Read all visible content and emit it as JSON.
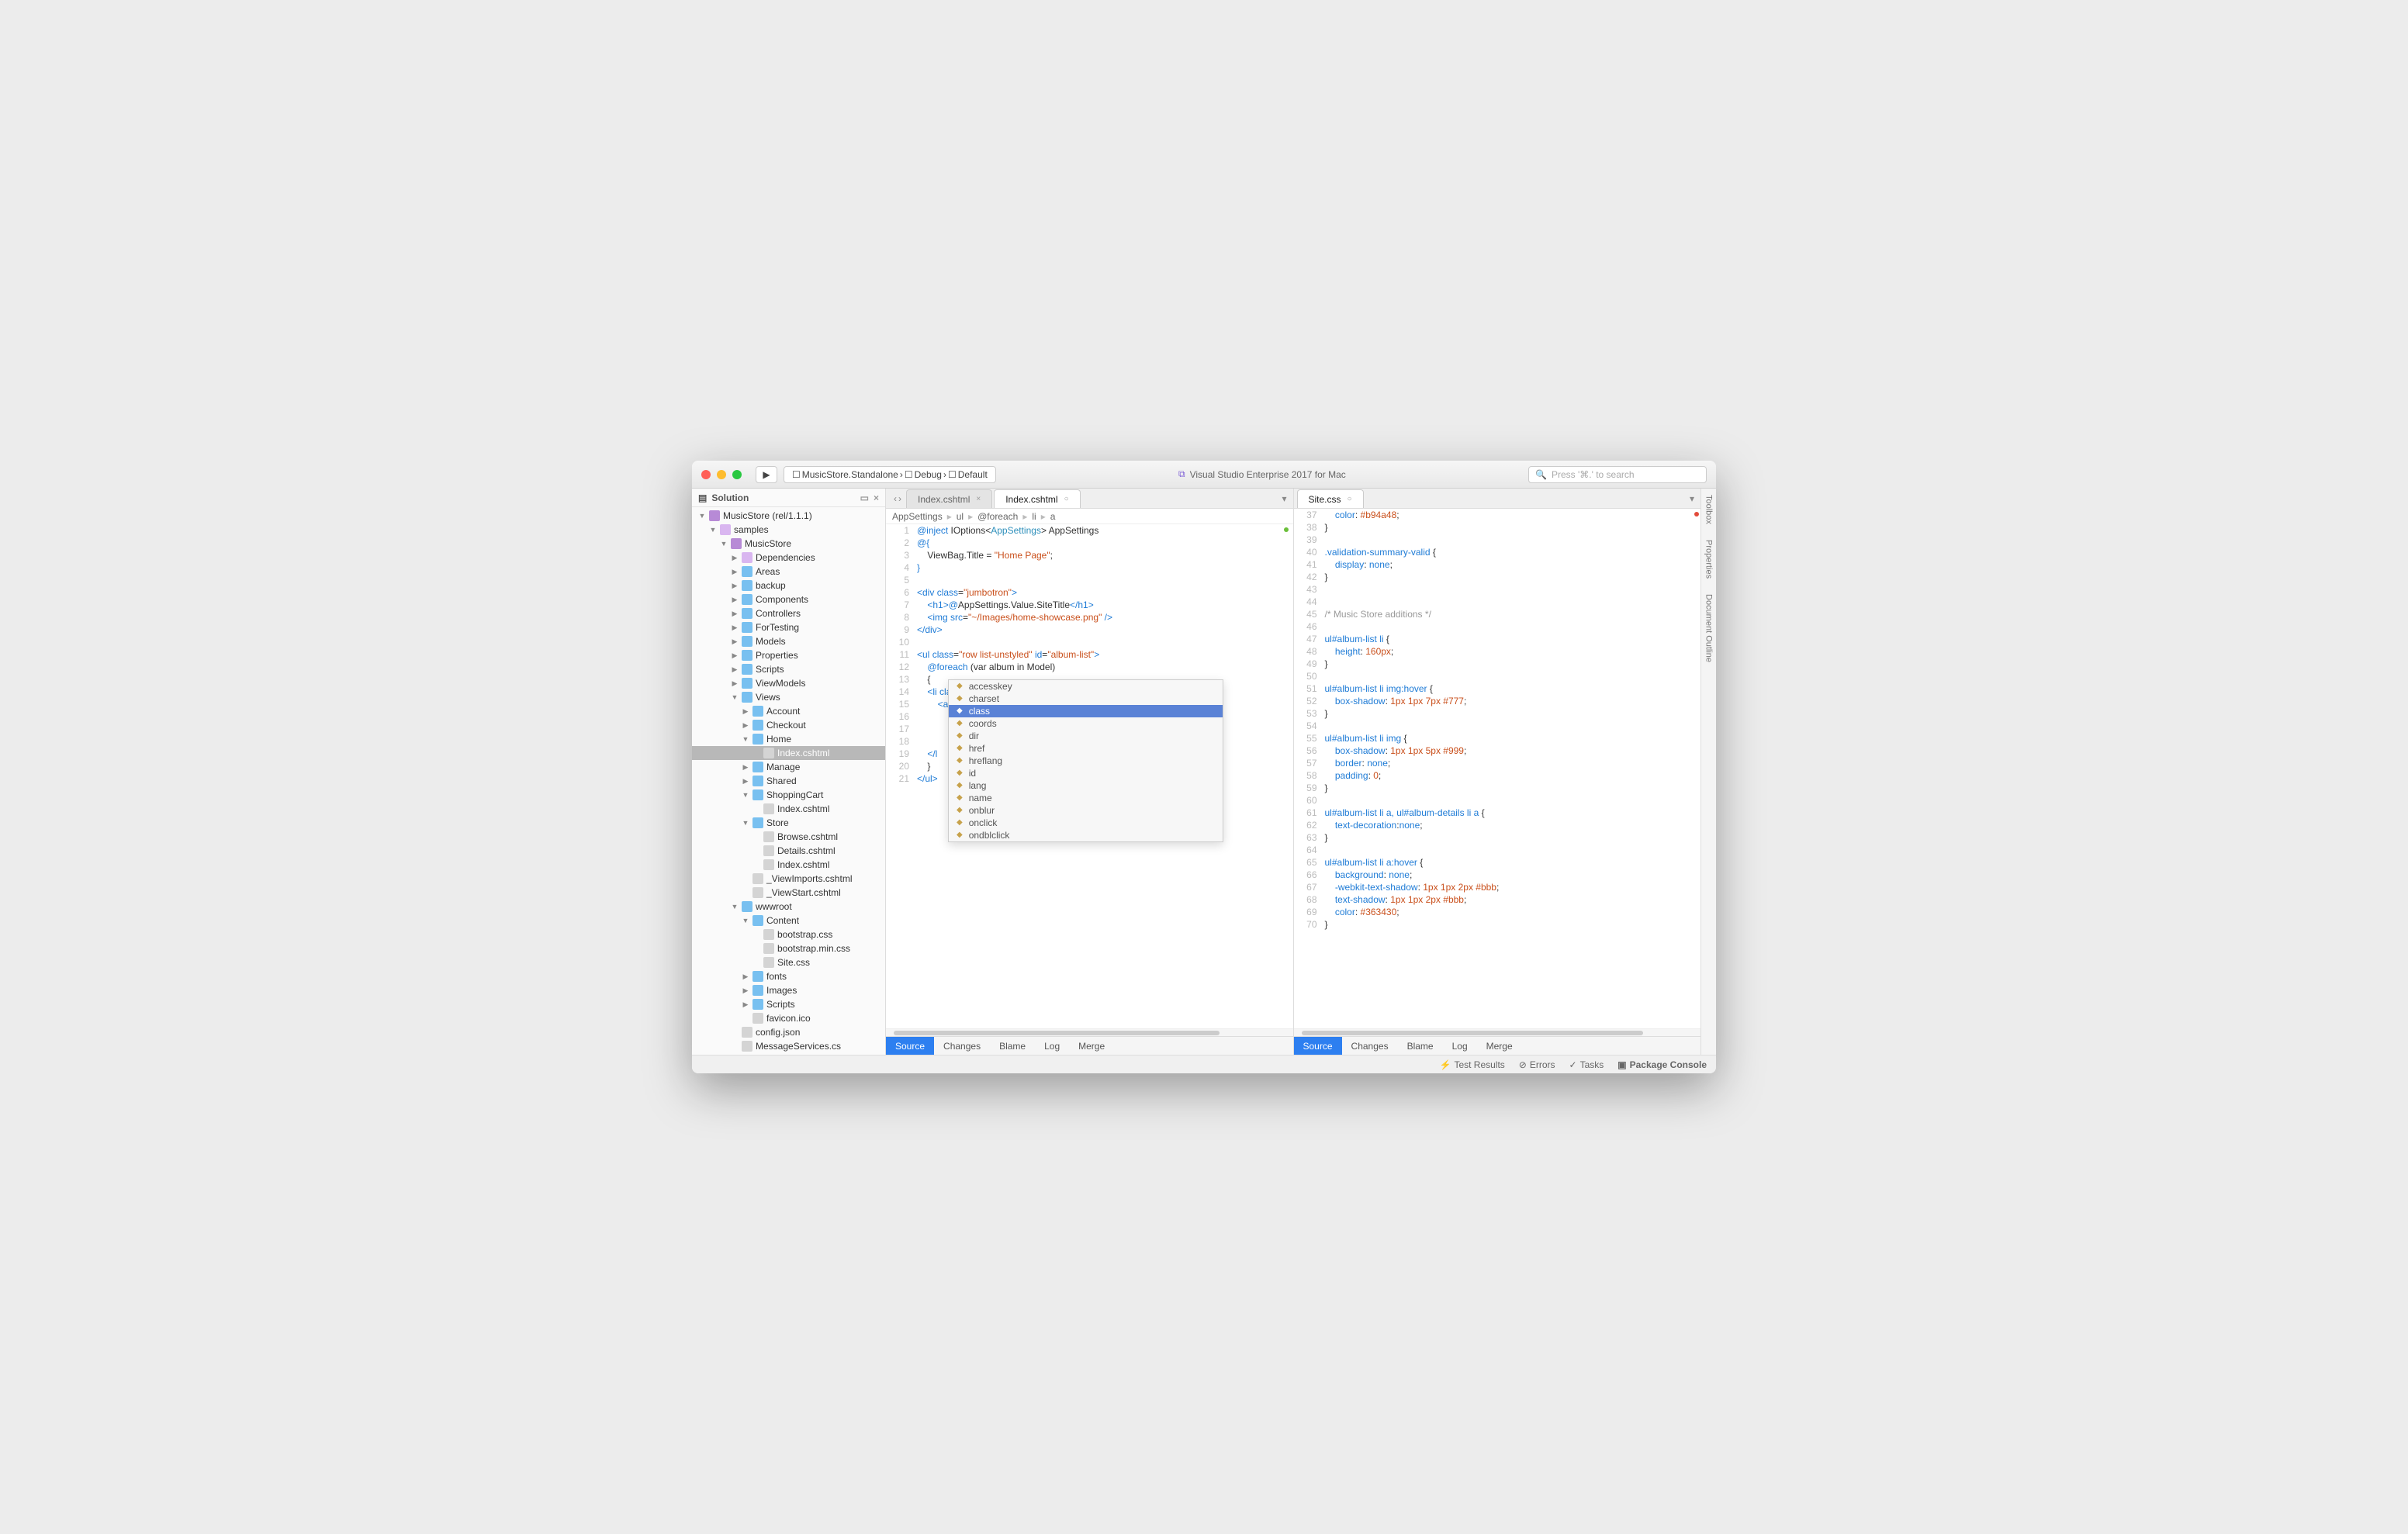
{
  "titlebar": {
    "run_target": "MusicStore.Standalone",
    "config": "Debug",
    "device": "Default",
    "title": "Visual Studio Enterprise 2017 for Mac",
    "search_placeholder": "Press '⌘.' to search"
  },
  "sidebar": {
    "title": "Solution",
    "root": "MusicStore (rel/1.1.1)",
    "items": [
      {
        "d": 0,
        "c": "▼",
        "i": "proj",
        "t": "MusicStore (rel/1.1.1)"
      },
      {
        "d": 1,
        "c": "▼",
        "i": "fldg",
        "t": "samples"
      },
      {
        "d": 2,
        "c": "▼",
        "i": "proj",
        "t": "MusicStore"
      },
      {
        "d": 3,
        "c": "▶",
        "i": "fldg",
        "t": "Dependencies"
      },
      {
        "d": 3,
        "c": "▶",
        "i": "fld",
        "t": "Areas"
      },
      {
        "d": 3,
        "c": "▶",
        "i": "fld",
        "t": "backup"
      },
      {
        "d": 3,
        "c": "▶",
        "i": "fld",
        "t": "Components"
      },
      {
        "d": 3,
        "c": "▶",
        "i": "fld",
        "t": "Controllers"
      },
      {
        "d": 3,
        "c": "▶",
        "i": "fld",
        "t": "ForTesting"
      },
      {
        "d": 3,
        "c": "▶",
        "i": "fld",
        "t": "Models"
      },
      {
        "d": 3,
        "c": "▶",
        "i": "fld",
        "t": "Properties"
      },
      {
        "d": 3,
        "c": "▶",
        "i": "fld",
        "t": "Scripts"
      },
      {
        "d": 3,
        "c": "▶",
        "i": "fld",
        "t": "ViewModels"
      },
      {
        "d": 3,
        "c": "▼",
        "i": "fld",
        "t": "Views"
      },
      {
        "d": 4,
        "c": "▶",
        "i": "fld",
        "t": "Account"
      },
      {
        "d": 4,
        "c": "▶",
        "i": "fld",
        "t": "Checkout"
      },
      {
        "d": 4,
        "c": "▼",
        "i": "fld",
        "t": "Home"
      },
      {
        "d": 5,
        "c": "",
        "i": "file",
        "t": "Index.cshtml",
        "sel": true
      },
      {
        "d": 4,
        "c": "▶",
        "i": "fld",
        "t": "Manage"
      },
      {
        "d": 4,
        "c": "▶",
        "i": "fld",
        "t": "Shared"
      },
      {
        "d": 4,
        "c": "▼",
        "i": "fld",
        "t": "ShoppingCart"
      },
      {
        "d": 5,
        "c": "",
        "i": "file",
        "t": "Index.cshtml"
      },
      {
        "d": 4,
        "c": "▼",
        "i": "fld",
        "t": "Store"
      },
      {
        "d": 5,
        "c": "",
        "i": "file",
        "t": "Browse.cshtml"
      },
      {
        "d": 5,
        "c": "",
        "i": "file",
        "t": "Details.cshtml"
      },
      {
        "d": 5,
        "c": "",
        "i": "file",
        "t": "Index.cshtml"
      },
      {
        "d": 4,
        "c": "",
        "i": "file",
        "t": "_ViewImports.cshtml"
      },
      {
        "d": 4,
        "c": "",
        "i": "file",
        "t": "_ViewStart.cshtml"
      },
      {
        "d": 3,
        "c": "▼",
        "i": "fld",
        "t": "wwwroot"
      },
      {
        "d": 4,
        "c": "▼",
        "i": "fld",
        "t": "Content"
      },
      {
        "d": 5,
        "c": "",
        "i": "file",
        "t": "bootstrap.css"
      },
      {
        "d": 5,
        "c": "",
        "i": "file",
        "t": "bootstrap.min.css"
      },
      {
        "d": 5,
        "c": "",
        "i": "file",
        "t": "Site.css"
      },
      {
        "d": 4,
        "c": "▶",
        "i": "fld",
        "t": "fonts"
      },
      {
        "d": 4,
        "c": "▶",
        "i": "fld",
        "t": "Images"
      },
      {
        "d": 4,
        "c": "▶",
        "i": "fld",
        "t": "Scripts"
      },
      {
        "d": 4,
        "c": "",
        "i": "file",
        "t": "favicon.ico"
      },
      {
        "d": 3,
        "c": "",
        "i": "file",
        "t": "config.json"
      },
      {
        "d": 3,
        "c": "",
        "i": "file",
        "t": "MessageServices.cs"
      }
    ]
  },
  "left_pane": {
    "tabs": [
      {
        "label": "Index.cshtml",
        "active": false
      },
      {
        "label": "Index.cshtml",
        "active": true
      }
    ],
    "crumbs": [
      "AppSettings",
      "ul",
      "@foreach",
      "li",
      "a"
    ],
    "autocomplete_selected": "class",
    "autocomplete": [
      "accesskey",
      "charset",
      "class",
      "coords",
      "dir",
      "href",
      "hreflang",
      "id",
      "lang",
      "name",
      "onblur",
      "onclick",
      "ondblclick"
    ]
  },
  "right_pane": {
    "tabs": [
      {
        "label": "Site.css",
        "active": true
      }
    ]
  },
  "bottom_tabs": [
    "Source",
    "Changes",
    "Blame",
    "Log",
    "Merge"
  ],
  "statusbar": {
    "test": "Test Results",
    "errors": "Errors",
    "tasks": "Tasks",
    "pkg": "Package Console"
  },
  "rail": [
    "Toolbox",
    "Properties",
    "Document Outline"
  ]
}
